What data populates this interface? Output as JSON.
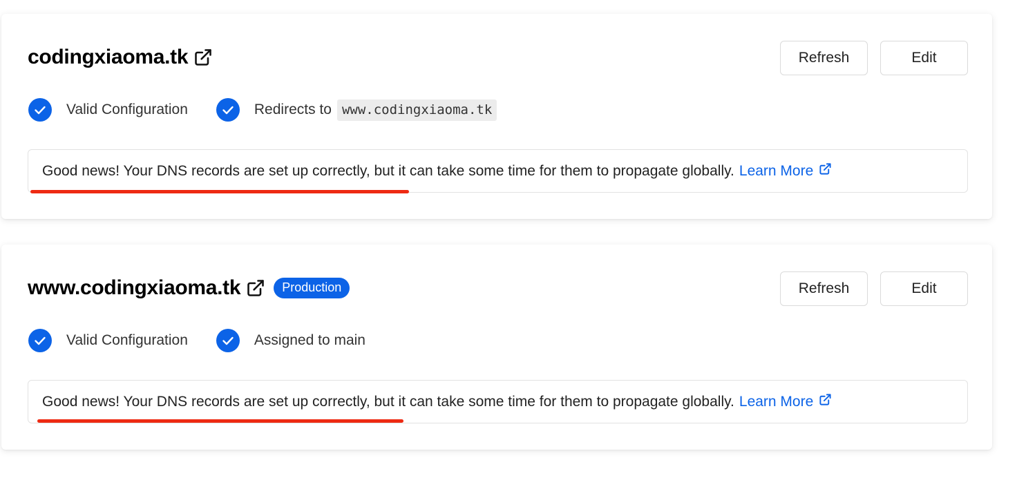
{
  "domains": [
    {
      "title": "codingxiaoma.tk",
      "badge": "",
      "refresh_label": "Refresh",
      "edit_label": "Edit",
      "status": {
        "valid_label": "Valid Configuration",
        "second_label": "Redirects to",
        "second_code": "www.codingxiaoma.tk"
      },
      "notice": {
        "text": "Good news! Your DNS records are set up correctly, but it can take some time for them to propagate globally.",
        "link": "Learn More"
      }
    },
    {
      "title": "www.codingxiaoma.tk",
      "badge": "Production",
      "refresh_label": "Refresh",
      "edit_label": "Edit",
      "status": {
        "valid_label": "Valid Configuration",
        "second_label": "Assigned to main"
      },
      "notice": {
        "text": "Good news! Your DNS records are set up correctly, but it can take some time for them to propagate globally.",
        "link": "Learn More"
      }
    }
  ],
  "colors": {
    "accent": "#0c63e7",
    "underline": "#ee2a13",
    "code_bg": "#ececec"
  },
  "icons": {
    "external_link": "external-link-icon",
    "check": "check-circle-icon"
  }
}
